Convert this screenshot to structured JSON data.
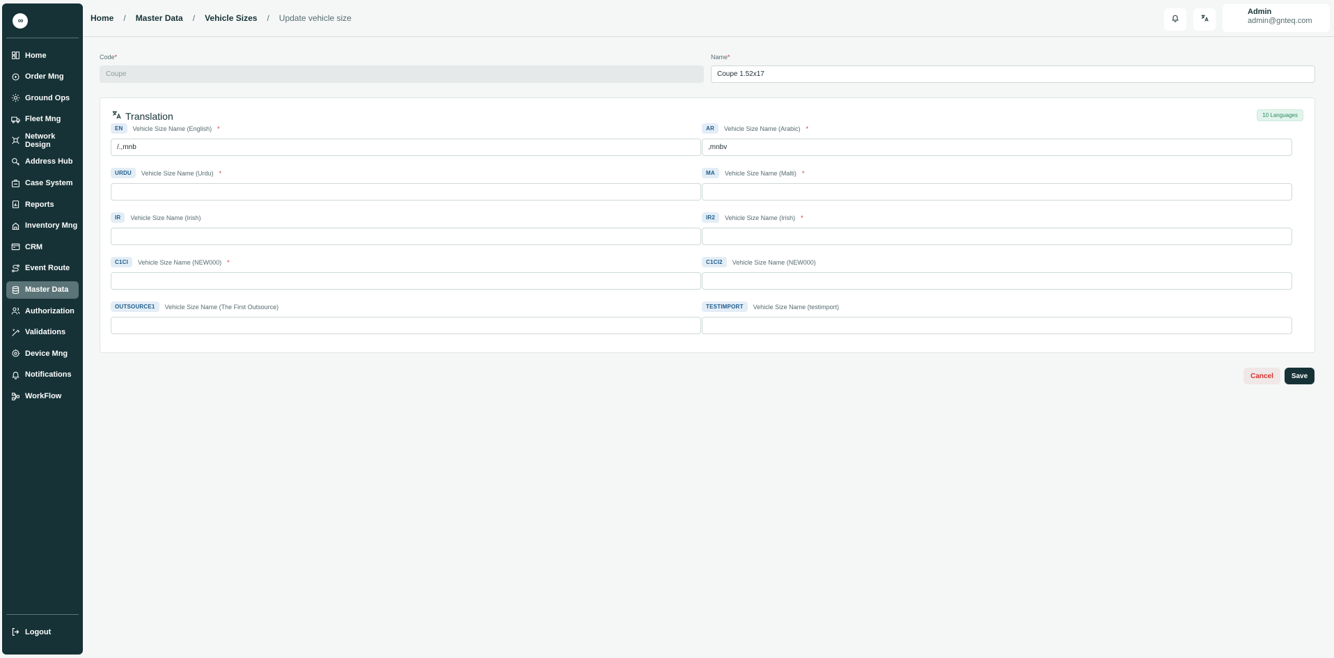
{
  "sidebar": {
    "logo_text": "∞",
    "items": [
      {
        "label": "Home",
        "icon": "home-icon"
      },
      {
        "label": "Order Mng",
        "icon": "order-icon"
      },
      {
        "label": "Ground Ops",
        "icon": "ground-ops-icon"
      },
      {
        "label": "Fleet Mng",
        "icon": "truck-icon"
      },
      {
        "label": "Network Design",
        "icon": "network-icon"
      },
      {
        "label": "Address Hub",
        "icon": "address-icon"
      },
      {
        "label": "Case System",
        "icon": "case-icon"
      },
      {
        "label": "Reports",
        "icon": "reports-icon"
      },
      {
        "label": "Inventory Mng",
        "icon": "inventory-icon"
      },
      {
        "label": "CRM",
        "icon": "crm-icon"
      },
      {
        "label": "Event Route",
        "icon": "route-icon"
      },
      {
        "label": "Master Data",
        "icon": "database-icon",
        "active": true
      },
      {
        "label": "Authorization",
        "icon": "users-icon"
      },
      {
        "label": "Validations",
        "icon": "validation-icon"
      },
      {
        "label": "Device Mng",
        "icon": "device-icon"
      },
      {
        "label": "Notifications",
        "icon": "bell-icon"
      },
      {
        "label": "WorkFlow",
        "icon": "workflow-icon"
      }
    ],
    "logout_label": "Logout"
  },
  "breadcrumb": {
    "items": [
      "Home",
      "Master Data",
      "Vehicle Sizes"
    ],
    "separator": "/",
    "current": "Update vehicle size"
  },
  "user": {
    "name": "Admin",
    "email": "admin@gnteq.com"
  },
  "form": {
    "code_label": "Code",
    "code_placeholder": "Coupe",
    "name_label": "Name",
    "name_value": "Coupe 1.52x17",
    "required_mark": "*"
  },
  "translation": {
    "title": "Translation",
    "badge": "10 Languages",
    "fields": [
      {
        "code": "EN",
        "label": "Vehicle Size Name (English)",
        "required": true,
        "value": "/.,mnb"
      },
      {
        "code": "AR",
        "label": "Vehicle Size Name (Arabic)",
        "required": true,
        "value": ",mnbv"
      },
      {
        "code": "URDU",
        "label": "Vehicle Size Name (Urdu)",
        "required": true,
        "value": ""
      },
      {
        "code": "MA",
        "label": "Vehicle Size Name (Malti)",
        "required": true,
        "value": ""
      },
      {
        "code": "IR",
        "label": "Vehicle Size Name (Irish)",
        "required": false,
        "value": ""
      },
      {
        "code": "IR2",
        "label": "Vehicle Size Name (Irish)",
        "required": true,
        "value": ""
      },
      {
        "code": "C1CI",
        "label": "Vehicle Size Name (NEW000)",
        "required": true,
        "value": ""
      },
      {
        "code": "C1CI2",
        "label": "Vehicle Size Name (NEW000)",
        "required": false,
        "value": ""
      },
      {
        "code": "OUTSOURCE1",
        "label": "Vehicle Size Name (The First Outsource)",
        "required": false,
        "value": ""
      },
      {
        "code": "TESTIMPORT",
        "label": "Vehicle Size Name (testimport)",
        "required": false,
        "value": ""
      }
    ]
  },
  "actions": {
    "cancel_label": "Cancel",
    "save_label": "Save"
  },
  "colors": {
    "sidebar": "#163236",
    "active": "#5b7478",
    "danger": "#d2332f",
    "badge": "#2a8a5c"
  }
}
